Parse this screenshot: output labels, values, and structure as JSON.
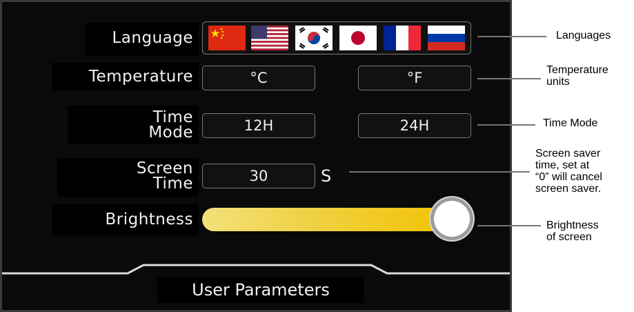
{
  "screen": {
    "rows": {
      "language": {
        "label": "Language"
      },
      "temperature": {
        "label": "Temperature",
        "options": [
          "°C",
          "°F"
        ]
      },
      "time_mode": {
        "label_line1": "Time",
        "label_line2": "Mode",
        "options": [
          "12H",
          "24H"
        ]
      },
      "screen_time": {
        "label_line1": "Screen",
        "label_line2": "Time",
        "value": "30",
        "unit": "S"
      },
      "brightness": {
        "label": "Brightness",
        "level_percent": 100
      }
    },
    "flags": [
      "china-flag-icon",
      "usa-flag-icon",
      "south-korea-flag-icon",
      "japan-flag-icon",
      "france-flag-icon",
      "russia-flag-icon"
    ],
    "footer_title": "User  Parameters",
    "colors": {
      "slider_start": "#f3e07a",
      "slider_end": "#f2c200",
      "frame": "#3a3a3a"
    }
  },
  "annotations": {
    "languages": "Languages",
    "temperature_line1": "Temperature",
    "temperature_line2": "units",
    "time_mode": "Time Mode",
    "screen_saver_line1": "Screen saver",
    "screen_saver_line2": "time, set at",
    "screen_saver_line3": "“0” will cancel",
    "screen_saver_line4": "screen saver.",
    "brightness_line1": "Brightness",
    "brightness_line2": "of screen"
  }
}
